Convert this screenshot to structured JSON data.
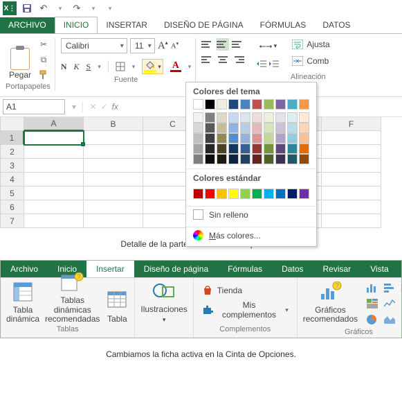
{
  "qat": {
    "undo_tip": "Deshacer",
    "redo_tip": "Rehacer",
    "save_tip": "Guardar"
  },
  "tabs1": {
    "archivo": "ARCHIVO",
    "inicio": "INICIO",
    "insertar": "INSERTAR",
    "diseno": "DISEÑO DE PÁGINA",
    "formulas": "FÓRMULAS",
    "datos": "DATOS"
  },
  "clipboard": {
    "paste": "Pegar",
    "group": "Portapapeles"
  },
  "font": {
    "family": "Calibri",
    "size": "11",
    "bold": "N",
    "italic": "K",
    "underline": "S",
    "group": "Fuente"
  },
  "align": {
    "group": "Alineación",
    "wrap": "Ajusta",
    "merge": "Comb"
  },
  "color_popup": {
    "theme_title": "Colores del tema",
    "std_title": "Colores estándar",
    "nofill": "Sin relleno",
    "more": "Más colores...",
    "theme_row1": [
      "#ffffff",
      "#000000",
      "#eeece1",
      "#1f497d",
      "#4f81bd",
      "#c0504d",
      "#9bbb59",
      "#8064a2",
      "#4bacc6",
      "#f79646"
    ],
    "theme_shades": [
      [
        "#f2f2f2",
        "#7f7f7f",
        "#ddd9c3",
        "#c6d9f0",
        "#dbe5f1",
        "#f2dcdb",
        "#ebf1dd",
        "#e5e0ec",
        "#dbeef3",
        "#fdeada"
      ],
      [
        "#d8d8d8",
        "#595959",
        "#c4bd97",
        "#8db3e2",
        "#b8cce4",
        "#e5b9b7",
        "#d7e3bc",
        "#ccc1d9",
        "#b7dde8",
        "#fbd5b5"
      ],
      [
        "#bfbfbf",
        "#3f3f3f",
        "#938953",
        "#548dd4",
        "#95b3d7",
        "#d99694",
        "#c3d69b",
        "#b2a2c7",
        "#92cddc",
        "#fac08f"
      ],
      [
        "#a5a5a5",
        "#262626",
        "#494429",
        "#17365d",
        "#366092",
        "#953734",
        "#76923c",
        "#5f497a",
        "#31859b",
        "#e36c09"
      ],
      [
        "#7f7f7f",
        "#0c0c0c",
        "#1d1b10",
        "#0f243e",
        "#244061",
        "#632423",
        "#4f6128",
        "#3f3151",
        "#205867",
        "#974806"
      ]
    ],
    "standard": [
      "#c00000",
      "#ff0000",
      "#ffc000",
      "#ffff00",
      "#92d050",
      "#00b050",
      "#00b0f0",
      "#0070c0",
      "#002060",
      "#7030a0"
    ]
  },
  "namebox": "A1",
  "chart_data": {
    "type": "table",
    "columns": [
      "A",
      "B",
      "C",
      "D",
      "E",
      "F"
    ],
    "rows": [
      "1",
      "2",
      "3",
      "4",
      "5",
      "6",
      "7"
    ],
    "active_cell": "A1"
  },
  "caption1": "Detalle de la parte de la Cinta de Opciones.",
  "tabs2": {
    "archivo": "Archivo",
    "inicio": "Inicio",
    "insertar": "Insertar",
    "diseno": "Diseño de página",
    "formulas": "Fórmulas",
    "datos": "Datos",
    "revisar": "Revisar",
    "vista": "Vista"
  },
  "ribbon2": {
    "tables": {
      "pivot": "Tabla dinámica",
      "recpivot": "Tablas dinámicas recomendadas",
      "table": "Tabla",
      "group": "Tablas"
    },
    "illus": {
      "label": "Ilustraciones"
    },
    "comp": {
      "store": "Tienda",
      "my": "Mis complementos",
      "group": "Complementos"
    },
    "charts": {
      "rec": "Gráficos recomendados",
      "group": "Gráficos"
    }
  },
  "caption2": "Cambiamos la ficha activa en la Cinta de Opciones."
}
